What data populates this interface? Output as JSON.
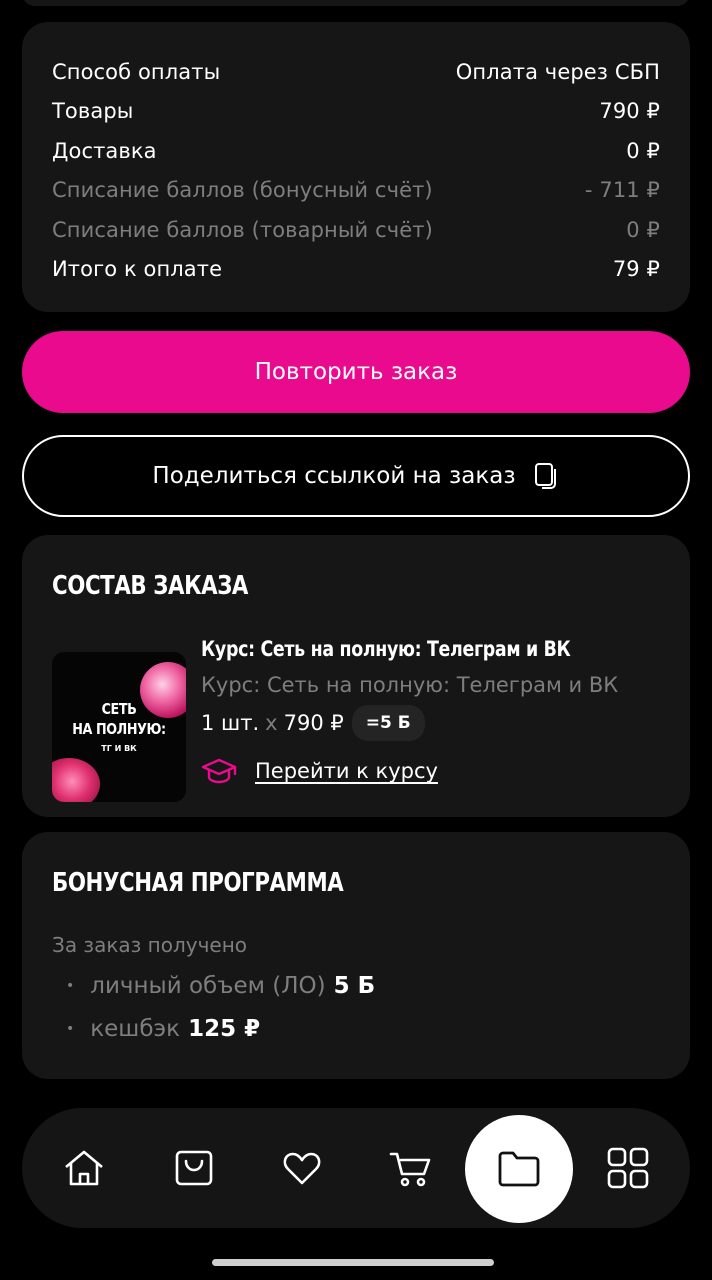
{
  "summary": {
    "rows": [
      {
        "label": "Способ оплаты",
        "value": "Оплата через СБП"
      },
      {
        "label": "Товары",
        "value": "790 ₽"
      },
      {
        "label": "Доставка",
        "value": "0 ₽"
      },
      {
        "label": "Списание баллов (бонусный счёт)",
        "value": "- 711 ₽"
      },
      {
        "label": "Списание баллов (товарный счёт)",
        "value": "0 ₽"
      },
      {
        "label": "Итого к оплате",
        "value": "79 ₽"
      }
    ]
  },
  "actions": {
    "repeat_label": "Повторить заказ",
    "share_label": "Поделиться ссылкой на заказ"
  },
  "order": {
    "title": "СОСТАВ ЗАКАЗА",
    "item": {
      "title": "Курс: Сеть на полную: Телеграм и ВК",
      "subtitle": "Курс: Сеть на полную: Телеграм и ВК",
      "qty": "1 шт.",
      "x": "x",
      "price": "790 ₽",
      "points_badge": "=5 Б",
      "cover": {
        "line1": "СЕТЬ",
        "line2": "НА ПОЛНУЮ:",
        "line3": "ТГ И ВК"
      },
      "link_label": "Перейти к курсу"
    }
  },
  "bonus": {
    "title": "БОНУСНАЯ ПРОГРАММА",
    "received_label": "За заказ получено",
    "lines": [
      {
        "label": "личный объем (ЛО)",
        "value": "5 Б"
      },
      {
        "label": "кешбэк",
        "value": "125 ₽"
      }
    ]
  },
  "nav": {
    "items": [
      "home-icon",
      "bag-icon",
      "heart-icon",
      "cart-icon",
      "folder-icon",
      "grid-icon"
    ],
    "active": "folder-icon"
  },
  "colors": {
    "accent": "#ea0a8e",
    "card": "#161616",
    "muted": "#7e7e7e",
    "background": "#000000"
  }
}
